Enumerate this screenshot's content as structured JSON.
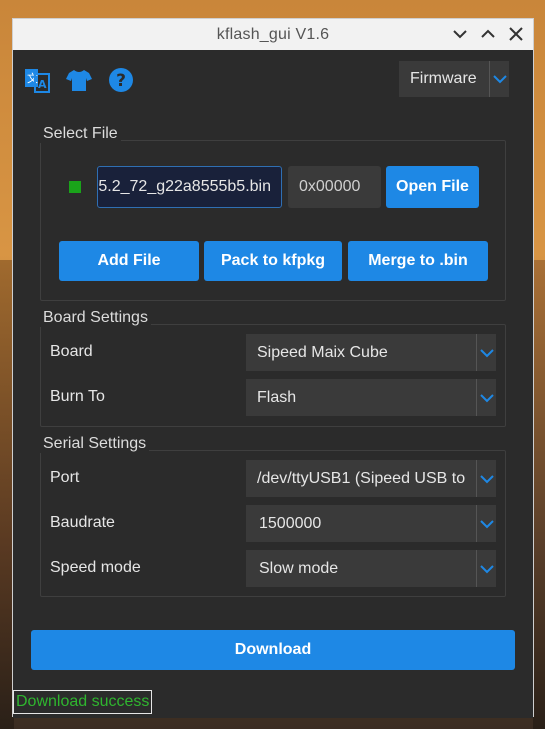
{
  "window": {
    "title": "kflash_gui V1.6"
  },
  "toolbar": {
    "icons": [
      "language-icon",
      "skin-icon",
      "help-icon"
    ],
    "mode_combo": "Firmware"
  },
  "select_file": {
    "group_title": "Select File",
    "file_path": "5.2_72_g22a8555b5.bin",
    "address": "0x00000",
    "open_button": "Open File",
    "add_file_button": "Add File",
    "pack_button": "Pack to kfpkg",
    "merge_button": "Merge to .bin"
  },
  "board_settings": {
    "group_title": "Board Settings",
    "board_label": "Board",
    "board_value": "Sipeed Maix Cube",
    "burn_to_label": "Burn To",
    "burn_to_value": "Flash"
  },
  "serial_settings": {
    "group_title": "Serial Settings",
    "port_label": "Port",
    "port_value": "/dev/ttyUSB1 (Sipeed USB to",
    "baudrate_label": "Baudrate",
    "baudrate_value": "1500000",
    "speed_label": "Speed mode",
    "speed_value": "Slow mode"
  },
  "actions": {
    "download_button": "Download"
  },
  "status": {
    "text": "Download success"
  },
  "colors": {
    "accent": "#1e88e5",
    "success": "#2fb52f",
    "panel": "#2b2b2b"
  }
}
